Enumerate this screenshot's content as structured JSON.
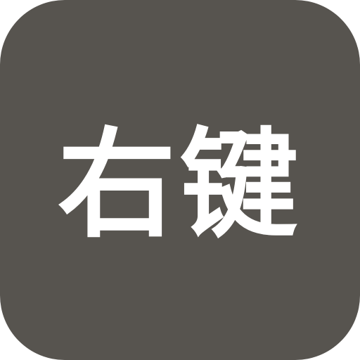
{
  "app_icon": {
    "label": "右键",
    "background_color": "#57544f",
    "text_color": "#ffffff"
  }
}
